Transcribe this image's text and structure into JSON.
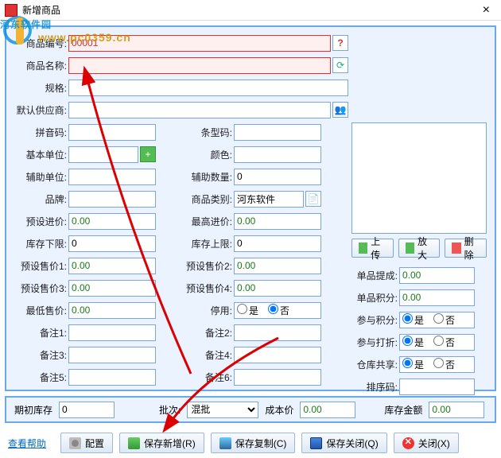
{
  "window": {
    "title": "新增商品",
    "close": "×"
  },
  "watermark": {
    "text": "河东软件园",
    "url": "www.pc0359.cn"
  },
  "fields": {
    "product_no_lbl": "商品编号:",
    "product_no": "00001",
    "product_name_lbl": "商品名称:",
    "product_name": "",
    "spec_lbl": "规格:",
    "spec": "",
    "supplier_lbl": "默认供应商:",
    "supplier": "",
    "pinyin_lbl": "拼音码:",
    "pinyin": "",
    "barcode_lbl": "条型码:",
    "barcode": "",
    "unit_lbl": "基本单位:",
    "unit": "",
    "color_lbl": "颜色:",
    "color": "",
    "aux_unit_lbl": "辅助单位:",
    "aux_unit": "",
    "aux_qty_lbl": "辅助数量:",
    "aux_qty": "0",
    "brand_lbl": "品牌:",
    "brand": "",
    "category_lbl": "商品类别:",
    "category": "河东软件",
    "preset_cost_lbl": "预设进价:",
    "preset_cost": "0.00",
    "max_cost_lbl": "最高进价:",
    "max_cost": "0.00",
    "stock_low_lbl": "库存下限:",
    "stock_low": "0",
    "stock_high_lbl": "库存上限:",
    "stock_high": "0",
    "preset_price1_lbl": "预设售价1:",
    "preset_price1": "0.00",
    "preset_price2_lbl": "预设售价2:",
    "preset_price2": "0.00",
    "preset_price3_lbl": "预设售价3:",
    "preset_price3": "0.00",
    "preset_price4_lbl": "预设售价4:",
    "preset_price4": "0.00",
    "min_price_lbl": "最低售价:",
    "min_price": "0.00",
    "stop_lbl": "停用:",
    "note1_lbl": "备注1:",
    "note1": "",
    "note2_lbl": "备注2:",
    "note2": "",
    "note3_lbl": "备注3:",
    "note3": "",
    "note4_lbl": "备注4:",
    "note4": "",
    "note5_lbl": "备注5:",
    "note5": "",
    "note6_lbl": "备注6:",
    "note6": "",
    "commission_lbl": "单品提成:",
    "commission": "0.00",
    "points_lbl": "单品积分:",
    "points": "0.00",
    "join_points_lbl": "参与积分:",
    "join_discount_lbl": "参与打折:",
    "share_stock_lbl": "仓库共享:",
    "sort_lbl": "排序码:",
    "sort": ""
  },
  "radios": {
    "yes": "是",
    "no": "否"
  },
  "img_btns": {
    "upload": "上传",
    "zoom": "放大",
    "delete": "删除"
  },
  "bottom": {
    "init_stock_lbl": "期初库存",
    "init_stock": "0",
    "batch_lbl": "批次:",
    "batch": "混批",
    "cost_lbl": "成本价",
    "cost": "0.00",
    "amount_lbl": "库存金额",
    "amount": "0.00"
  },
  "footer": {
    "help": "查看帮助",
    "config": "配置",
    "save_new": "保存新增(R)",
    "save_copy": "保存复制(C)",
    "save_close": "保存关闭(Q)",
    "close": "关闭(X)"
  }
}
